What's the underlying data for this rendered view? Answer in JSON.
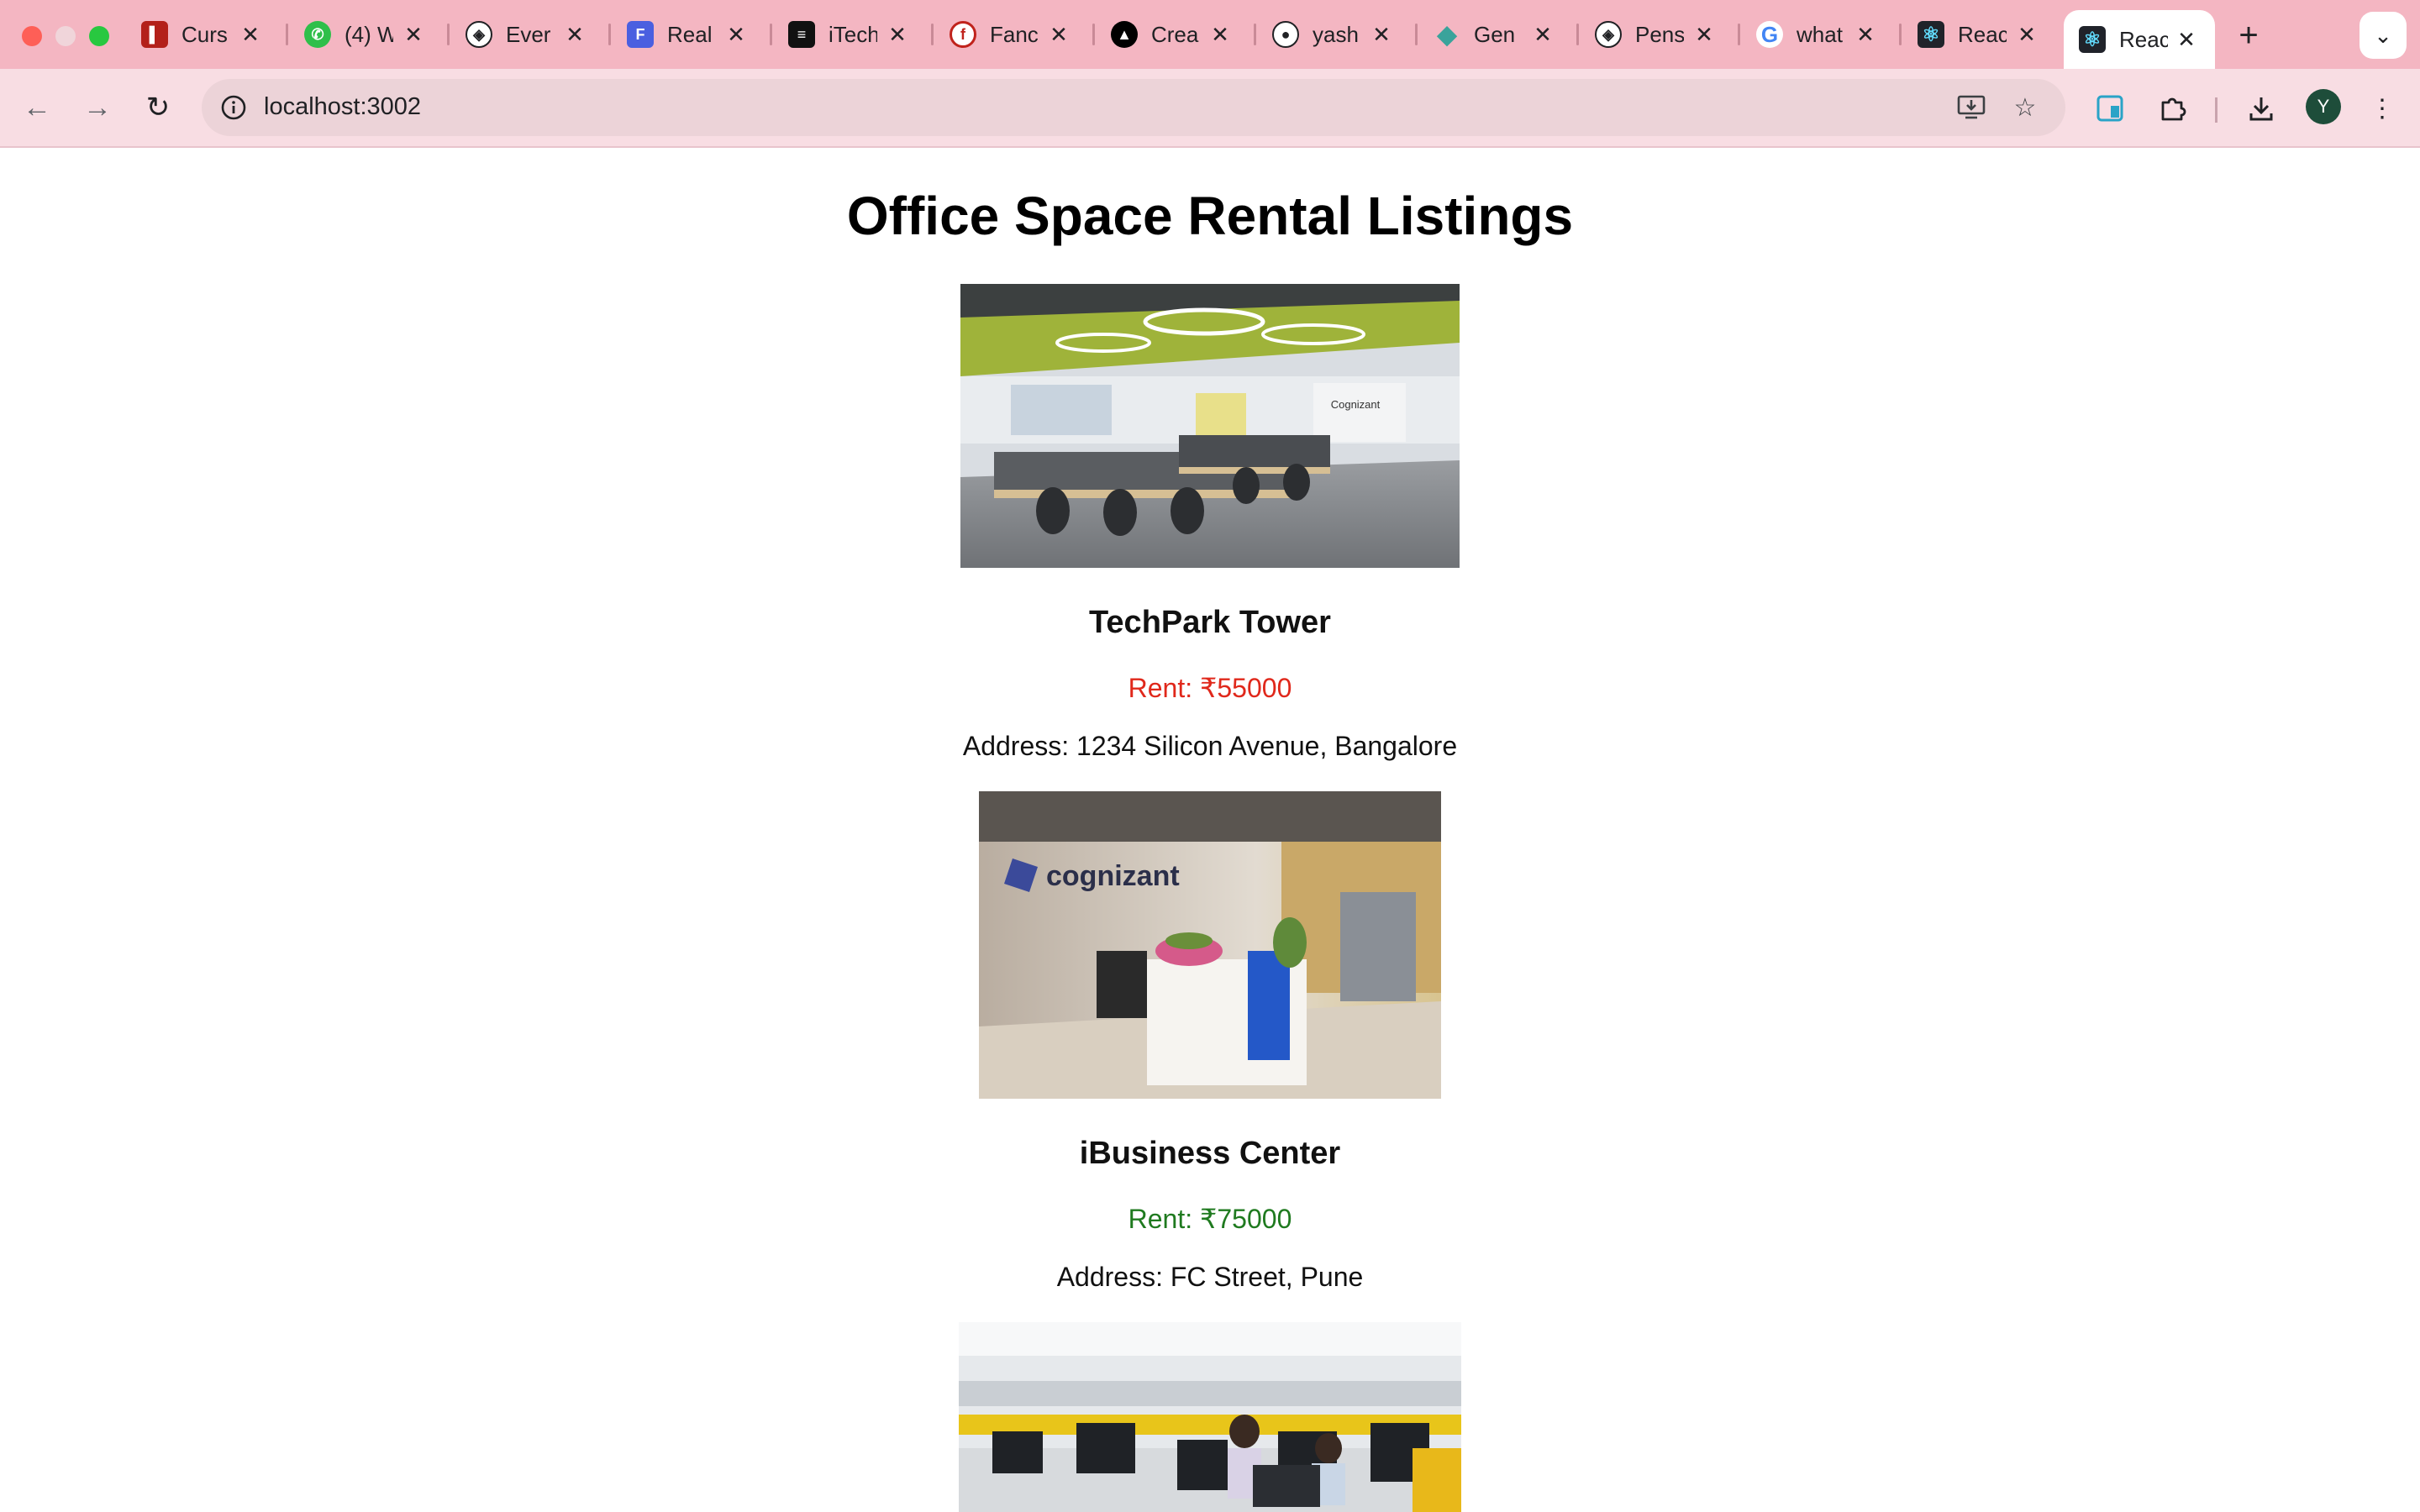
{
  "browser": {
    "tabs": [
      {
        "title": "Curs",
        "icon": "red-document-icon"
      },
      {
        "title": "(4) W",
        "icon": "whatsapp-icon"
      },
      {
        "title": "Ever",
        "icon": "codepen-icon"
      },
      {
        "title": "Real",
        "icon": "blue-form-icon"
      },
      {
        "title": "iTech",
        "icon": "itech-icon"
      },
      {
        "title": "Fanc",
        "icon": "red-logo-icon"
      },
      {
        "title": "Crea",
        "icon": "triangle-logo-icon"
      },
      {
        "title": "yash",
        "icon": "github-icon"
      },
      {
        "title": "Gen",
        "icon": "teal-diamond-icon"
      },
      {
        "title": "Pens",
        "icon": "codepen-icon"
      },
      {
        "title": "what",
        "icon": "google-icon"
      },
      {
        "title": "Reac",
        "icon": "react-icon"
      },
      {
        "title": "Reac",
        "icon": "react-icon"
      }
    ],
    "active_tab_index": 12,
    "url": "localhost:3002",
    "profile_initial": "Y"
  },
  "page": {
    "title": "Office Space Rental Listings",
    "listings": [
      {
        "name": "TechPark Tower",
        "rent": "Rent: ₹55000",
        "rent_color": "#e0281b",
        "address": "Address: 1234 Silicon Avenue, Bangalore",
        "photo_sign": "Cognizant"
      },
      {
        "name": "iBusiness Center",
        "rent": "Rent: ₹75000",
        "rent_color": "#1f7a1f",
        "address": "Address: FC Street, Pune",
        "photo_sign": "cognizant"
      },
      {
        "name": "",
        "rent": "",
        "address": ""
      }
    ]
  }
}
